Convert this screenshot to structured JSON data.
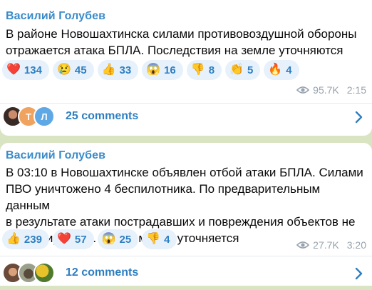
{
  "posts": [
    {
      "author": "Василий Голубев",
      "text": "В районе Новошахтинска силами противовоздушной обороны\nотражается атака БПЛА. Последствия на земле уточняются",
      "reactions": [
        {
          "emoji": "❤️",
          "count": "134"
        },
        {
          "emoji": "😢",
          "count": "45"
        },
        {
          "emoji": "👍",
          "count": "33"
        },
        {
          "emoji": "😱",
          "count": "16"
        },
        {
          "emoji": "👎",
          "count": "8"
        },
        {
          "emoji": "👏",
          "count": "5"
        },
        {
          "emoji": "🔥",
          "count": "4"
        }
      ],
      "views": "95.7K",
      "time": "2:15",
      "avatar_letters": [
        "Т",
        "Л"
      ],
      "comments_label": "25 comments"
    },
    {
      "author": "Василий Голубев",
      "text": "В 03:10 в Новошахтинске объявлен отбой атаки БПЛА. Силами\nПВО уничтожено 4 беспилотника. По предварительным данным\nв результате атаки пострадавших и повреждения объектов не\nзафиксировано. Информация уточняется",
      "reactions": [
        {
          "emoji": "👍",
          "count": "239"
        },
        {
          "emoji": "❤️",
          "count": "57"
        },
        {
          "emoji": "😱",
          "count": "25"
        },
        {
          "emoji": "👎",
          "count": "4"
        }
      ],
      "views": "27.7K",
      "time": "3:20",
      "comments_label": "12 comments"
    }
  ],
  "colors": {
    "accent": "#2e7fc1",
    "author": "#3a8bc9",
    "reaction_bg": "#e7f1fb",
    "meta": "#98a3ad",
    "background": "#d9e4c3"
  }
}
